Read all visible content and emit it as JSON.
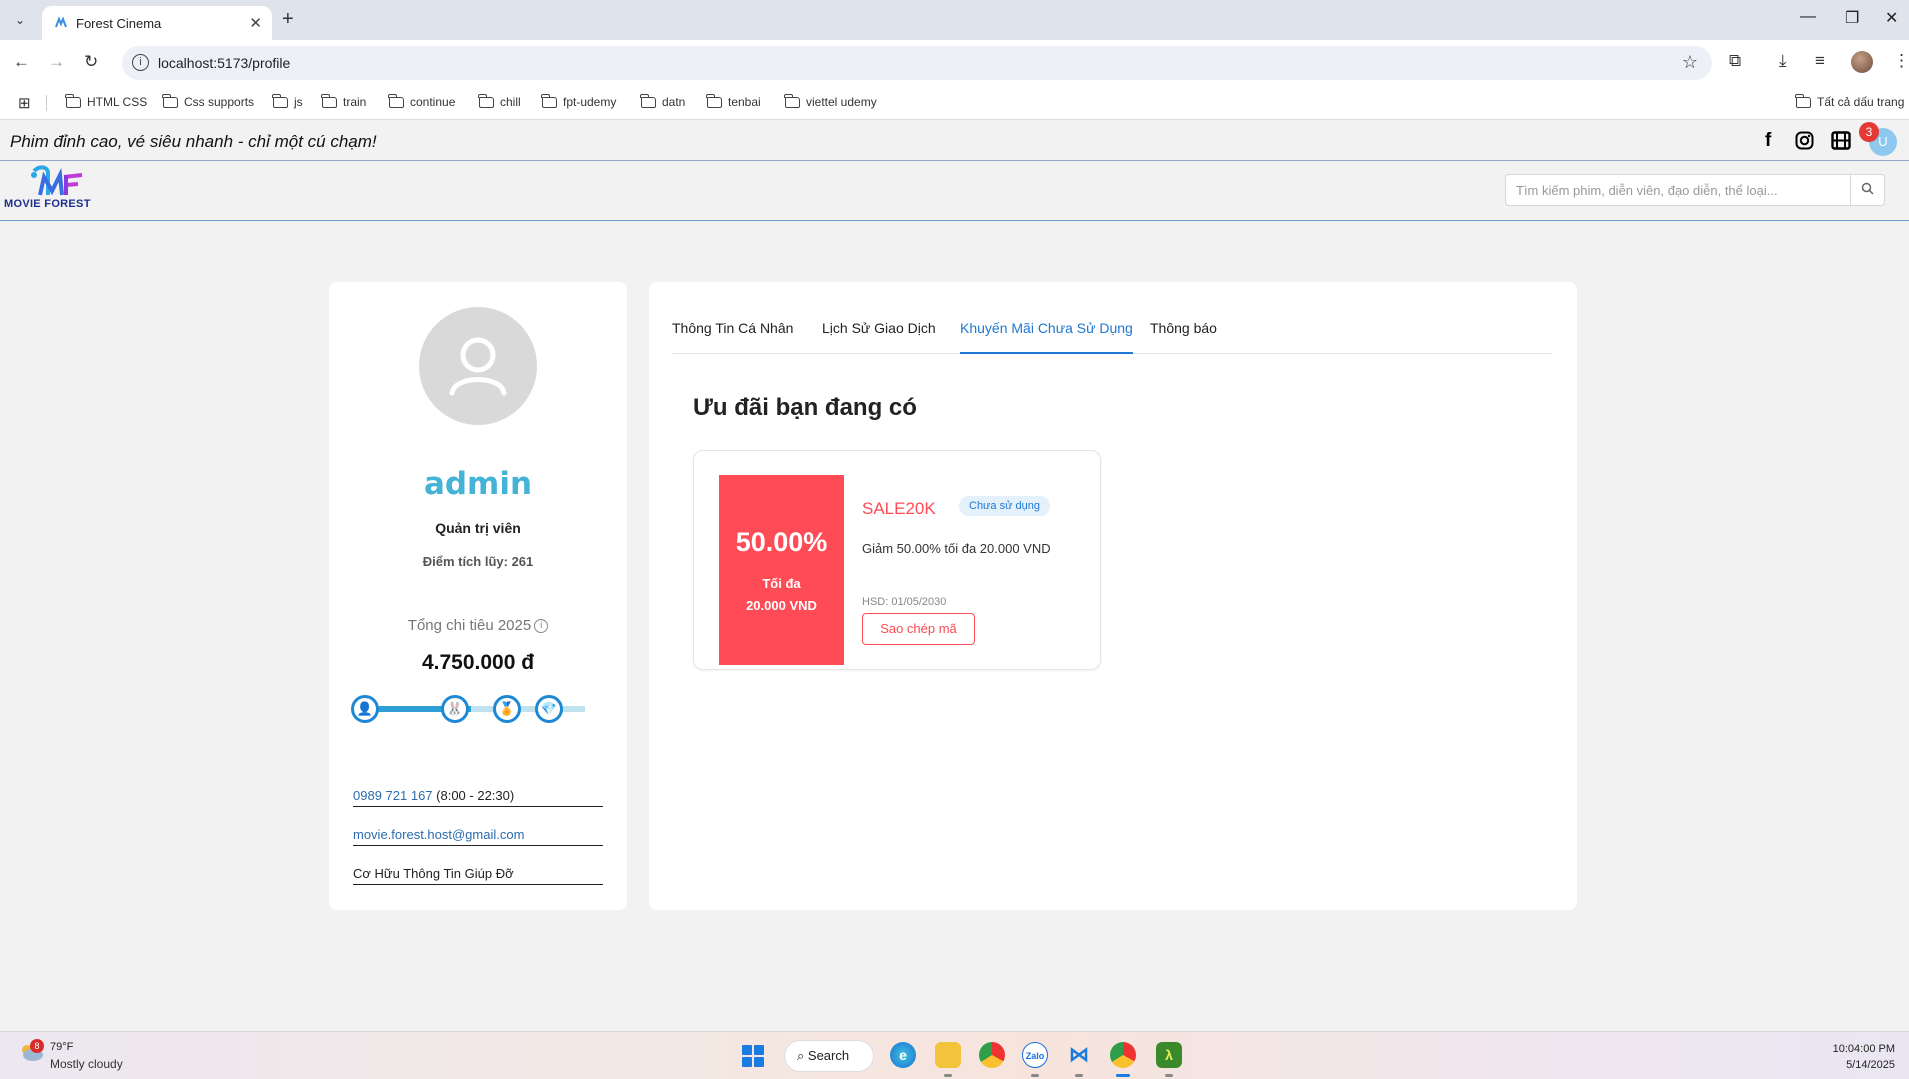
{
  "browser": {
    "tab_title": "Forest Cinema",
    "url": "localhost:5173/profile",
    "bookmarks": [
      "HTML CSS",
      "Css supports",
      "js",
      "train",
      "continue",
      "chill",
      "fpt-udemy",
      "datn",
      "tenbai",
      "viettel udemy"
    ],
    "all_bookmarks": "Tất cả dấu trang"
  },
  "site": {
    "slogan": "Phim đỉnh cao, vé siêu nhanh - chỉ một cú chạm!",
    "logo_text": "MOVIE FOREST",
    "notification_count": "3",
    "user_initial": "U",
    "search_placeholder": "Tìm kiếm phim, diễn viên, đạo diễn, thể loại..."
  },
  "profile": {
    "username": "admin",
    "role": "Quản trị viên",
    "points": "Điểm tích lũy: 261",
    "spend_label": "Tổng chi tiêu 2025",
    "spend_amount": "4.750.000 đ",
    "spend_progress": 0.48,
    "phone": "0989 721 167",
    "hours": "(8:00 - 22:30)",
    "email": "movie.forest.host@gmail.com",
    "help": "Cơ Hữu Thông Tin Giúp Đỡ"
  },
  "tabs": [
    {
      "label": "Thông Tin Cá Nhân",
      "active": false
    },
    {
      "label": "Lịch Sử Giao Dịch",
      "active": false
    },
    {
      "label": "Khuyến Mãi Chưa Sử Dụng",
      "active": true
    },
    {
      "label": "Thông báo",
      "active": false
    }
  ],
  "promotions": {
    "title": "Ưu đãi bạn đang có",
    "coupon": {
      "percent": "50.00%",
      "cap_line1": "Tối đa",
      "cap_line2": "20.000 VND",
      "code": "SALE20K",
      "status": "Chưa sử dụng",
      "description": "Giảm 50.00% tối đa 20.000 VND",
      "expiry": "HSD: 01/05/2030",
      "copy_label": "Sao chép mã"
    }
  },
  "taskbar": {
    "weather_badge": "8",
    "temperature": "79°F",
    "weather": "Mostly cloudy",
    "search_label": "Search",
    "time": "10:04:00 PM",
    "date": "5/14/2025"
  },
  "colors": {
    "accent": "#1e78d2",
    "coupon_red": "#ff4b55",
    "username": "#45b3d6"
  }
}
